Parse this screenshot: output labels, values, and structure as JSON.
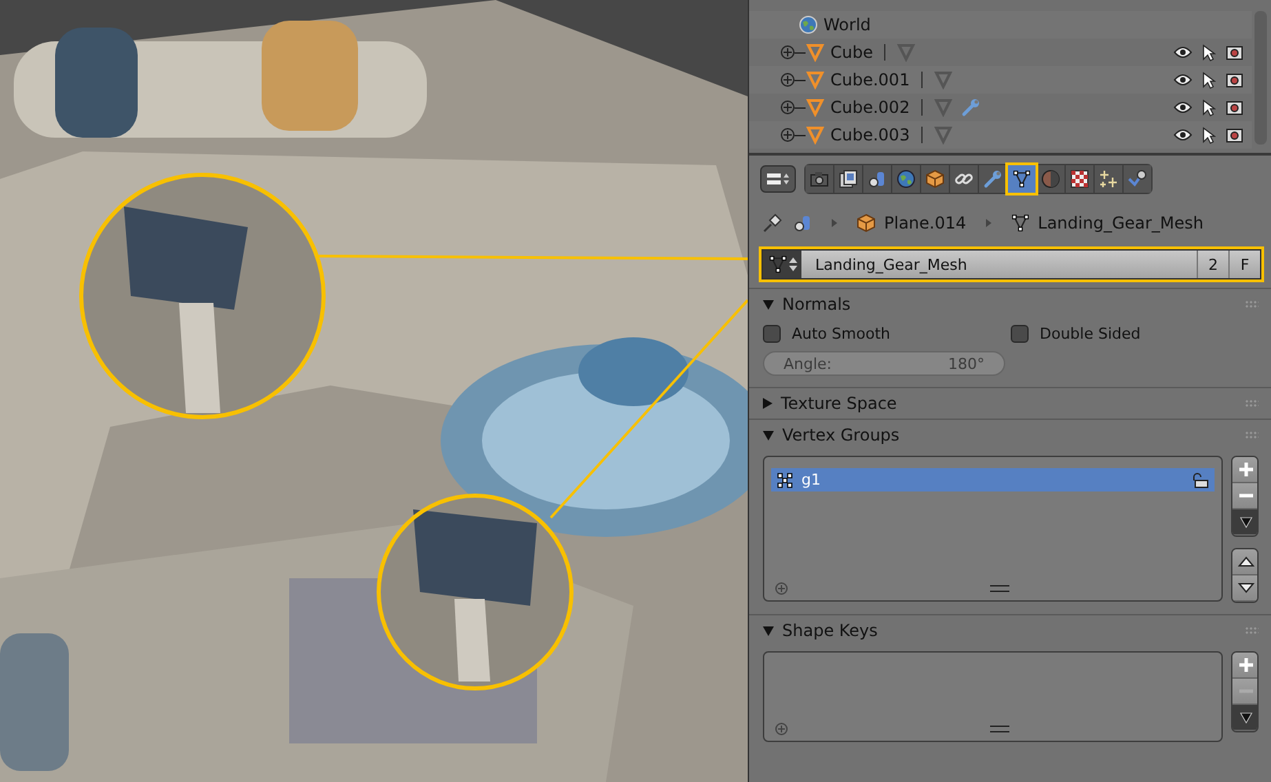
{
  "outliner": {
    "rows": [
      {
        "label": "World",
        "kind": "world"
      },
      {
        "label": "Cube",
        "kind": "mesh",
        "has_modifier": false
      },
      {
        "label": "Cube.001",
        "kind": "mesh",
        "has_modifier": false
      },
      {
        "label": "Cube.002",
        "kind": "mesh",
        "has_modifier": true
      },
      {
        "label": "Cube.003",
        "kind": "mesh",
        "has_modifier": false
      }
    ]
  },
  "properties": {
    "tabs": [
      {
        "kind": "render",
        "selected": false,
        "callout": false
      },
      {
        "kind": "render_layers",
        "selected": false,
        "callout": false
      },
      {
        "kind": "scene",
        "selected": false,
        "callout": false
      },
      {
        "kind": "world",
        "selected": false,
        "callout": false
      },
      {
        "kind": "object",
        "selected": false,
        "callout": false
      },
      {
        "kind": "constraints",
        "selected": false,
        "callout": false
      },
      {
        "kind": "modifiers",
        "selected": false,
        "callout": false
      },
      {
        "kind": "data",
        "selected": true,
        "callout": true
      },
      {
        "kind": "material",
        "selected": false,
        "callout": false
      },
      {
        "kind": "texture",
        "selected": false,
        "callout": false
      },
      {
        "kind": "particles",
        "selected": false,
        "callout": false
      },
      {
        "kind": "physics",
        "selected": false,
        "callout": false
      }
    ],
    "breadcrumb": [
      "Plane.014",
      "Landing_Gear_Mesh"
    ],
    "mesh_field": {
      "value": "Landing_Gear_Mesh",
      "users": "2",
      "fake_user": "F",
      "callout": true
    },
    "panels": [
      {
        "title": "Normals",
        "kind": "normals",
        "expanded": true,
        "checkboxes": [
          {
            "label": "Auto Smooth",
            "checked": false
          },
          {
            "label": "Double Sided",
            "checked": false
          }
        ],
        "angle": {
          "label": "Angle:",
          "value": "180°",
          "disabled": true
        }
      },
      {
        "title": "Texture Space",
        "expanded": false
      },
      {
        "title": "Vertex Groups",
        "kind": "list",
        "expanded": true,
        "move_buttons": true,
        "remove_disabled": false,
        "items": [
          {
            "label": "g1",
            "selected": true,
            "locked": false
          }
        ]
      },
      {
        "title": "Shape Keys",
        "kind": "list",
        "expanded": true,
        "move_buttons": false,
        "remove_disabled": true
      }
    ]
  }
}
